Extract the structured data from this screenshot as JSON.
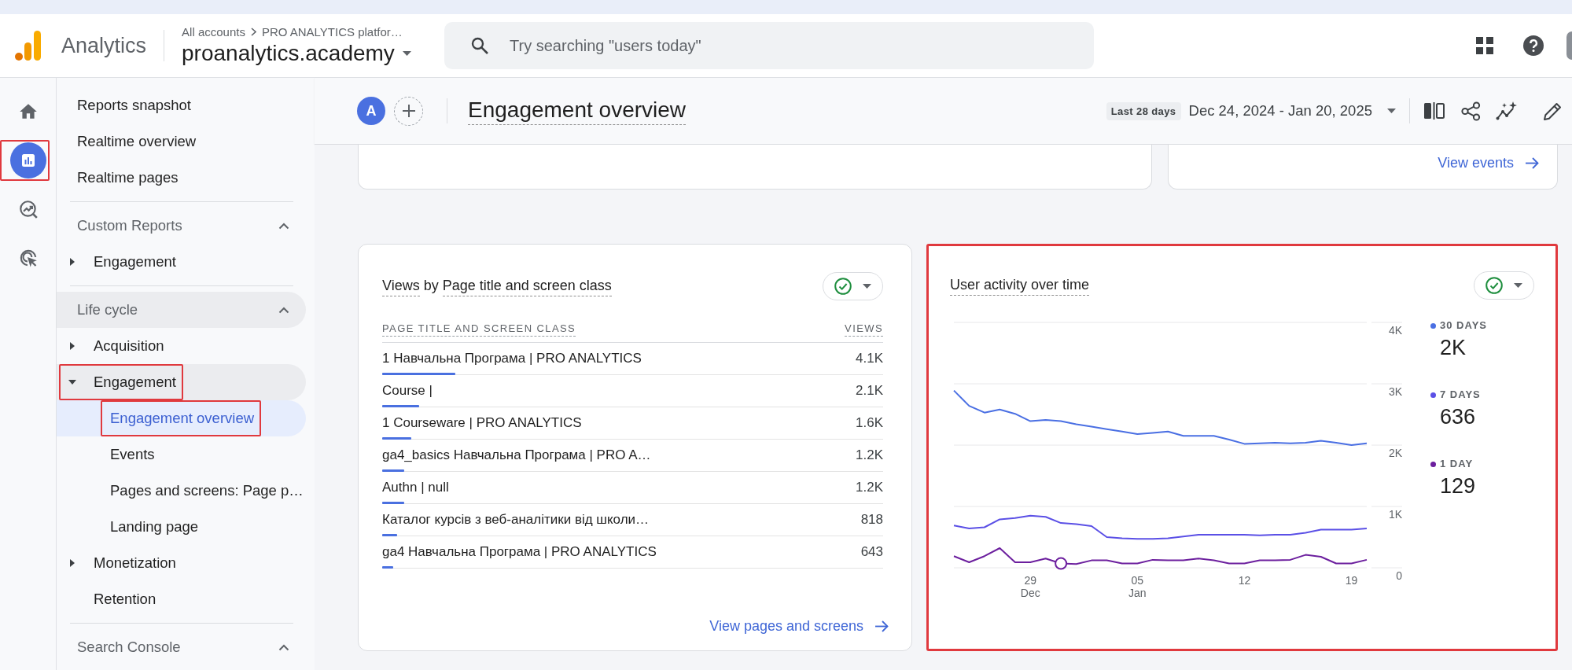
{
  "app_bar": {
    "product": "Analytics",
    "breadcrumb": [
      "All accounts",
      "PRO ANALYTICS platfor…"
    ],
    "property": "proanalytics.academy",
    "search": {
      "placeholder": "Try searching \"users today\""
    }
  },
  "rail": [
    {
      "kind": "home",
      "selected": false,
      "highlighted": false
    },
    {
      "kind": "reports",
      "selected": true,
      "highlighted": true
    },
    {
      "kind": "explore",
      "selected": false,
      "highlighted": false
    },
    {
      "kind": "advertising",
      "selected": false,
      "highlighted": false
    }
  ],
  "nav": {
    "items": [
      {
        "label": "Reports snapshot",
        "selected": false
      },
      {
        "label": "Realtime overview",
        "selected": false
      },
      {
        "label": "Realtime pages",
        "selected": false
      }
    ],
    "sections": [
      {
        "title": "Custom Reports",
        "expanded": true,
        "hovered": false,
        "children": [
          {
            "kind": "group",
            "label": "Engagement",
            "expanded": false,
            "highlighted": false
          }
        ]
      },
      {
        "title": "Life cycle",
        "expanded": true,
        "hovered": true,
        "children": [
          {
            "kind": "group",
            "label": "Acquisition",
            "expanded": false,
            "highlighted": false
          },
          {
            "kind": "group",
            "label": "Engagement",
            "expanded": true,
            "highlighted": true,
            "children": [
              {
                "label": "Engagement overview",
                "selected": true,
                "highlighted": true
              },
              {
                "label": "Events",
                "selected": false,
                "highlighted": false
              },
              {
                "label": "Pages and screens: Page p…",
                "selected": false,
                "highlighted": false
              },
              {
                "label": "Landing page",
                "selected": false,
                "highlighted": false
              }
            ]
          },
          {
            "kind": "group",
            "label": "Monetization",
            "expanded": false,
            "highlighted": false
          },
          {
            "kind": "link",
            "label": "Retention",
            "selected": false,
            "highlighted": false
          }
        ]
      },
      {
        "title": "Search Console",
        "expanded": true,
        "hovered": false
      }
    ]
  },
  "page_header": {
    "avatar": "A",
    "title": "Engagement overview",
    "date_preset": "Last 28 days",
    "date_range": "Dec 24, 2024 - Jan 20, 2025"
  },
  "top_cards": [
    {
      "kind": "blank"
    },
    {
      "kind": "link",
      "link": "View events"
    }
  ],
  "cards": [
    {
      "kind": "table",
      "highlighted": false,
      "title": [
        {
          "text": "Views",
          "editable": true
        },
        {
          "text": "by",
          "editable": false
        },
        {
          "text": "Page title and screen class",
          "editable": true
        }
      ],
      "columns": [
        "PAGE TITLE AND SCREEN CLASS",
        "VIEWS"
      ],
      "rows": [
        {
          "title": "1 Навчальна Програма | PRO ANALYTICS",
          "views": "4.1K",
          "level": 0.146
        },
        {
          "title": "Course |",
          "views": "2.1K",
          "level": 0.074
        },
        {
          "title": "1 Courseware | PRO ANALYTICS",
          "views": "1.6K",
          "level": 0.058
        },
        {
          "title": "ga4_basics Навчальна Програма | PRO A…",
          "views": "1.2K",
          "level": 0.044
        },
        {
          "title": "Authn | null",
          "views": "1.2K",
          "level": 0.044
        },
        {
          "title": "Каталог курсів з веб-аналітики від школи…",
          "views": "818",
          "level": 0.03
        },
        {
          "title": "ga4 Навчальна Програма | PRO ANALYTICS",
          "views": "643",
          "level": 0.022
        }
      ],
      "link": "View pages and screens"
    },
    {
      "kind": "chart",
      "highlighted": true,
      "title": [
        {
          "text": "User activity over time",
          "editable": true
        }
      ],
      "chart_data": {
        "type": "line",
        "grid": true,
        "categories": [
          null,
          null,
          null,
          null,
          null,
          "29\nDec",
          null,
          null,
          null,
          null,
          null,
          null,
          "05\nJan",
          null,
          null,
          null,
          null,
          null,
          null,
          "12",
          null,
          null,
          null,
          null,
          null,
          null,
          "19",
          null
        ],
        "ylim": [
          0,
          4000
        ],
        "yticks": [
          {
            "value": 0,
            "label": "0"
          },
          {
            "value": 1000,
            "label": "1K"
          },
          {
            "value": 2000,
            "label": "2K"
          },
          {
            "value": 3000,
            "label": "3K"
          },
          {
            "value": 4000,
            "label": "4K"
          }
        ],
        "series": [
          {
            "name": "30 DAYS",
            "color": "#4a6fe3",
            "values": [
              2890,
              2640,
              2530,
              2580,
              2510,
              2390,
              2410,
              2390,
              2340,
              2300,
              2260,
              2220,
              2180,
              2200,
              2220,
              2150,
              2150,
              2150,
              2090,
              2020,
              2030,
              2040,
              2030,
              2040,
              2070,
              2040,
              2000,
              2030
            ]
          },
          {
            "name": "7 DAYS",
            "color": "#5b50e6",
            "values": [
              690,
              640,
              660,
              790,
              810,
              850,
              830,
              730,
              710,
              680,
              500,
              480,
              470,
              470,
              480,
              510,
              540,
              540,
              540,
              540,
              530,
              540,
              540,
              570,
              620,
              620,
              620,
              640
            ]
          },
          {
            "name": "1 DAY",
            "color": "#6c1f9e",
            "values": [
              190,
              90,
              190,
              320,
              90,
              90,
              150,
              70,
              60,
              120,
              120,
              70,
              70,
              130,
              120,
              120,
              150,
              120,
              70,
              70,
              120,
              120,
              130,
              210,
              180,
              70,
              70,
              130
            ]
          },
          {
            "color": "#6c1f9e",
            "marker": "circle",
            "values": [
              null,
              null,
              null,
              null,
              null,
              null,
              null,
              70,
              null,
              null,
              null,
              null,
              null,
              null,
              null,
              null,
              null,
              null,
              null,
              null,
              null,
              null,
              null,
              null,
              null,
              null,
              null,
              null
            ]
          }
        ]
      },
      "legend": [
        {
          "value": "2K"
        },
        {
          "value": "636"
        },
        {
          "value": "129"
        }
      ]
    }
  ]
}
